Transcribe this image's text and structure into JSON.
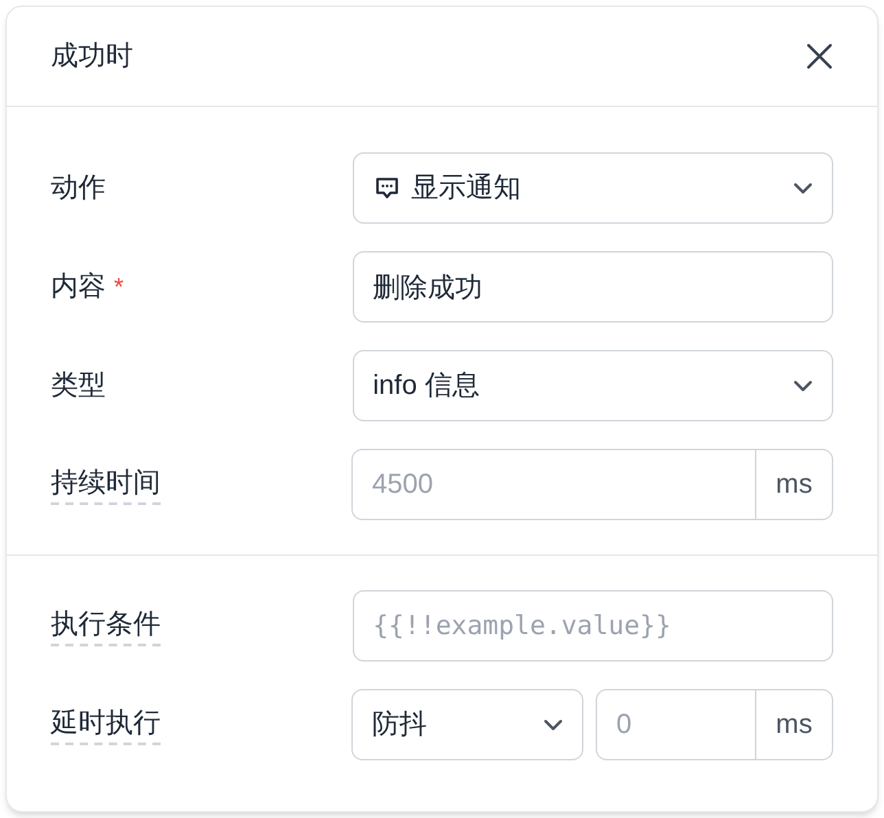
{
  "dialog": {
    "title": "成功时"
  },
  "sections": [
    {
      "fields": [
        {
          "label": "动作",
          "kind": "action-select",
          "value": "显示通知",
          "hint": false
        },
        {
          "label": "内容",
          "kind": "text",
          "value": "删除成功",
          "required_mark": "*",
          "hint": false
        },
        {
          "label": "类型",
          "kind": "select",
          "value": "info 信息",
          "hint": false
        },
        {
          "label": "持续时间",
          "kind": "number-unit",
          "placeholder": "4500",
          "unit": "ms",
          "hint": true
        }
      ]
    },
    {
      "fields": [
        {
          "label": "执行条件",
          "kind": "code",
          "placeholder": "{{!!example.value}}",
          "hint": true
        },
        {
          "label": "延时执行",
          "kind": "delay",
          "mode": "防抖",
          "placeholder": "0",
          "unit": "ms",
          "hint": true
        }
      ]
    }
  ]
}
